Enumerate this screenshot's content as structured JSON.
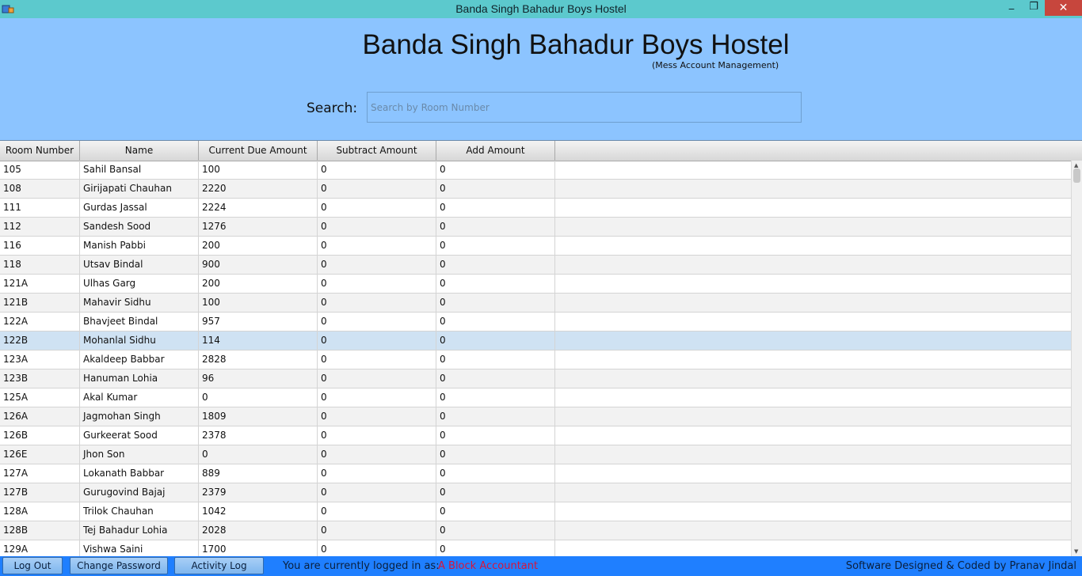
{
  "window": {
    "title": "Banda Singh Bahadur Boys Hostel",
    "min_glyph": "_",
    "max_glyph": "❐",
    "close_glyph": "✕",
    "app_icon": "java-app-icon"
  },
  "header": {
    "title": "Banda Singh Bahadur Boys Hostel",
    "subtitle": "(Mess Account Management)"
  },
  "search": {
    "label": "Search:",
    "placeholder": "Search by Room Number",
    "value": ""
  },
  "table": {
    "columns": [
      "Room Number",
      "Name",
      "Current Due Amount",
      "Subtract Amount",
      "Add Amount",
      ""
    ],
    "selected_row": 9,
    "rows": [
      [
        "105",
        "Sahil Bansal",
        "100",
        "0",
        "0"
      ],
      [
        "108",
        "Girijapati Chauhan",
        "2220",
        "0",
        "0"
      ],
      [
        "111",
        "Gurdas Jassal",
        "2224",
        "0",
        "0"
      ],
      [
        "112",
        "Sandesh Sood",
        "1276",
        "0",
        "0"
      ],
      [
        "116",
        "Manish Pabbi",
        "200",
        "0",
        "0"
      ],
      [
        "118",
        "Utsav Bindal",
        "900",
        "0",
        "0"
      ],
      [
        "121A",
        "Ulhas Garg",
        "200",
        "0",
        "0"
      ],
      [
        "121B",
        "Mahavir Sidhu",
        "100",
        "0",
        "0"
      ],
      [
        "122A",
        "Bhavjeet Bindal",
        "957",
        "0",
        "0"
      ],
      [
        "122B",
        "Mohanlal Sidhu",
        "114",
        "0",
        "0"
      ],
      [
        "123A",
        "Akaldeep Babbar",
        "2828",
        "0",
        "0"
      ],
      [
        "123B",
        "Hanuman Lohia",
        "96",
        "0",
        "0"
      ],
      [
        "125A",
        "Akal Kumar",
        "0",
        "0",
        "0"
      ],
      [
        "126A",
        "Jagmohan Singh",
        "1809",
        "0",
        "0"
      ],
      [
        "126B",
        "Gurkeerat Sood",
        "2378",
        "0",
        "0"
      ],
      [
        "126E",
        "Jhon Son",
        "0",
        "0",
        "0"
      ],
      [
        "127A",
        "Lokanath Babbar",
        "889",
        "0",
        "0"
      ],
      [
        "127B",
        "Gurugovind Bajaj",
        "2379",
        "0",
        "0"
      ],
      [
        "128A",
        "Trilok Chauhan",
        "1042",
        "0",
        "0"
      ],
      [
        "128B",
        "Tej Bahadur Lohia",
        "2028",
        "0",
        "0"
      ],
      [
        "129A",
        "Vishwa Saini",
        "1700",
        "0",
        "0"
      ]
    ]
  },
  "footer": {
    "logout_label": "Log Out",
    "change_password_label": "Change Password",
    "activity_log_label": "Activity Log",
    "logged_in_label": "You are currently logged in as:",
    "logged_in_user": "A Block Accountant",
    "credit": "Software Designed & Coded by Pranav Jindal"
  },
  "colors": {
    "titlebar": "#5cc9cd",
    "background": "#8cc4ff",
    "footer": "#1f7fff",
    "user_highlight": "#d6153a",
    "selected_row": "#cfe2f3"
  }
}
